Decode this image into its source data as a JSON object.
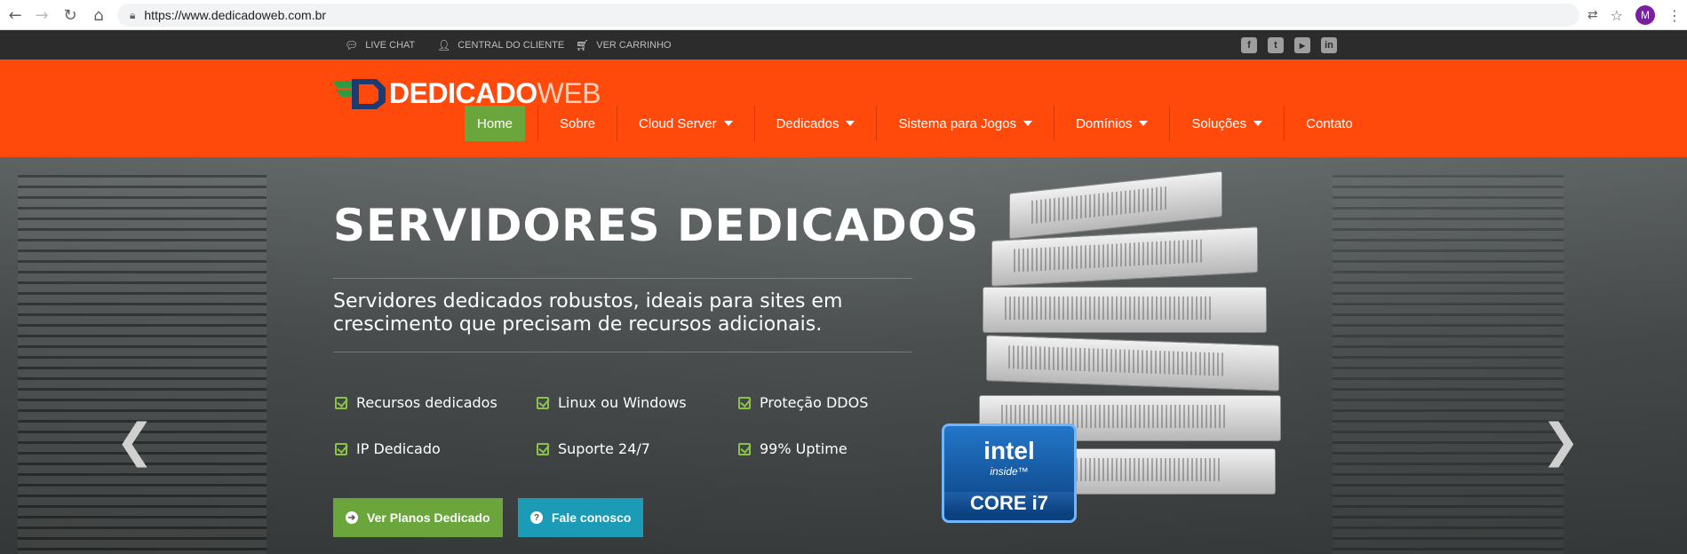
{
  "browser": {
    "url": "https://www.dedicadoweb.com.br",
    "avatar_letter": "M"
  },
  "topbar": {
    "items": [
      {
        "label": "LIVE CHAT",
        "icon": "chat-icon"
      },
      {
        "label": "CENTRAL DO CLIENTE",
        "icon": "user-icon"
      },
      {
        "label": "VER CARRINHO",
        "icon": "cart-icon"
      }
    ],
    "social": [
      "facebook-icon",
      "twitter-icon",
      "youtube-icon",
      "linkedin-icon"
    ]
  },
  "header": {
    "logo_part1": "DEDICADO",
    "logo_part2": "WEB",
    "menu": [
      {
        "label": "Home",
        "active": true,
        "dropdown": false
      },
      {
        "label": "Sobre",
        "dropdown": false
      },
      {
        "label": "Cloud Server",
        "dropdown": true
      },
      {
        "label": "Dedicados",
        "dropdown": true
      },
      {
        "label": "Sistema para Jogos",
        "dropdown": true
      },
      {
        "label": "Domínios",
        "dropdown": true
      },
      {
        "label": "Soluções",
        "dropdown": true
      },
      {
        "label": "Contato",
        "dropdown": false
      }
    ],
    "colors": {
      "bar": "#ff4a0c",
      "active": "#6aa63b"
    }
  },
  "hero": {
    "title": "SERVIDORES DEDICADOS",
    "subtitle": "Servidores dedicados robustos, ideais para sites em crescimento que precisam de recursos adicionais.",
    "features": [
      "Recursos dedicados",
      "Linux ou Windows",
      "Proteção DDOS",
      "IP Dedicado",
      "Suporte 24/7",
      "99% Uptime"
    ],
    "buttons": [
      {
        "label": "Ver Planos Dedicado",
        "color": "#6aa63b"
      },
      {
        "label": "Fale conosco",
        "color": "#1c9bb6"
      }
    ],
    "badge": {
      "brand": "intel",
      "tag": "inside™",
      "model": "CORE i7"
    },
    "prev": "❮",
    "next": "❯"
  }
}
